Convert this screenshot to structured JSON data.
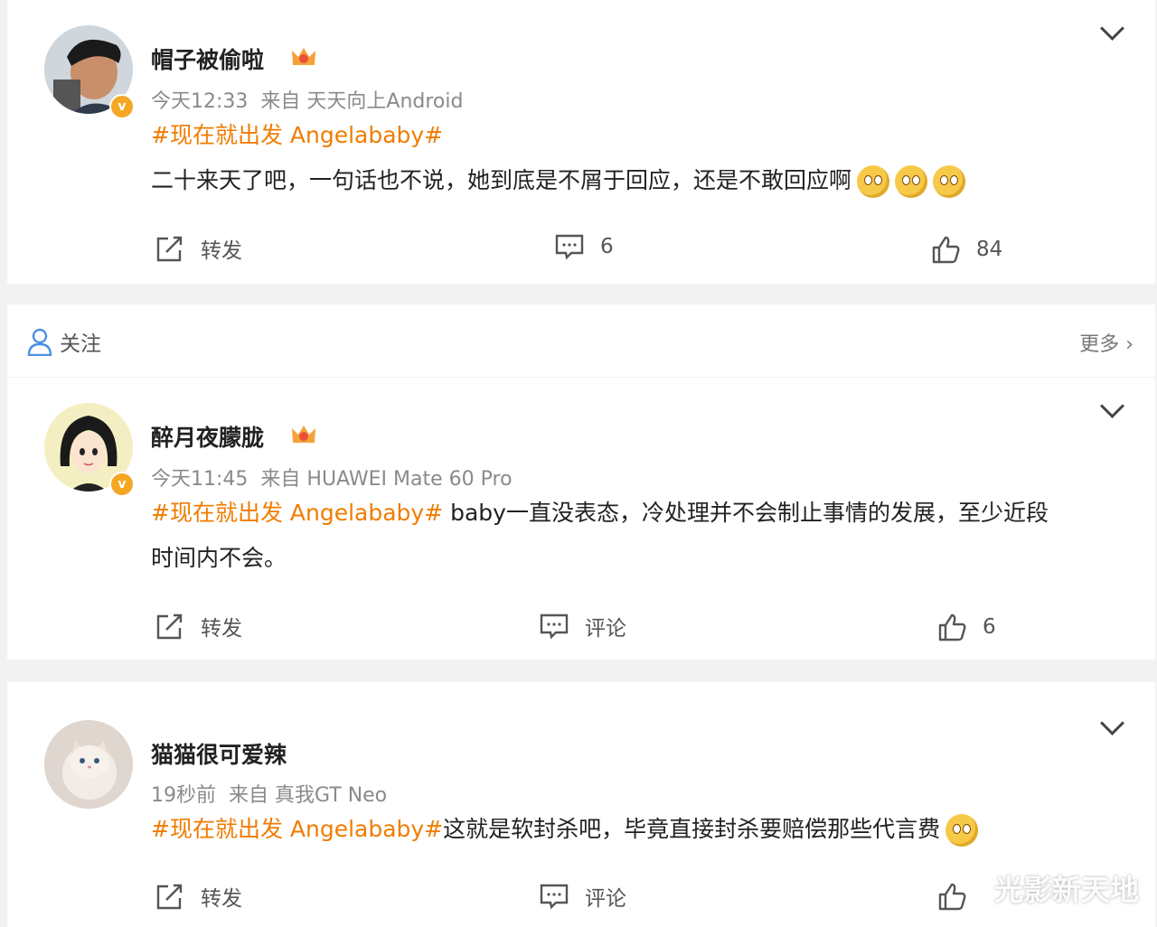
{
  "follow_bar": {
    "follow_label": "关注",
    "more_label": "更多 ›"
  },
  "posts": [
    {
      "username": "帽子被偷啦",
      "time": "今天12:33",
      "source": "来自 天天向上Android",
      "topic": "#现在就出发 Angelababy#",
      "text": "二十来天了吧，一句话也不说，她到底是不屑于回应，还是不敢回应啊",
      "emoji_count": 3,
      "repost_label": "转发",
      "comment_label": "6",
      "like_label": "84"
    },
    {
      "username": "醉月夜朦胧",
      "time": "今天11:45",
      "source": "来自 HUAWEI Mate 60 Pro",
      "topic": "#现在就出发 Angelababy#",
      "text_line1": " baby一直没表态，冷处理并不会制止事情的发展，至少近段",
      "text_line2": "时间内不会。",
      "repost_label": "转发",
      "comment_label": "评论",
      "like_label": "6"
    },
    {
      "username": "猫猫很可爱辣",
      "time": "19秒前",
      "source": "来自 真我GT Neo",
      "topic": "#现在就出发 Angelababy#",
      "text": "这就是软封杀吧，毕竟直接封杀要赔偿那些代言费",
      "repost_label": "转发",
      "comment_label": "评论",
      "like_label": ""
    }
  ],
  "watermark": "光影新天地",
  "colors": {
    "topic": "#f07c00",
    "badge": "#f5a623",
    "follow_icon": "#4a90e2"
  }
}
